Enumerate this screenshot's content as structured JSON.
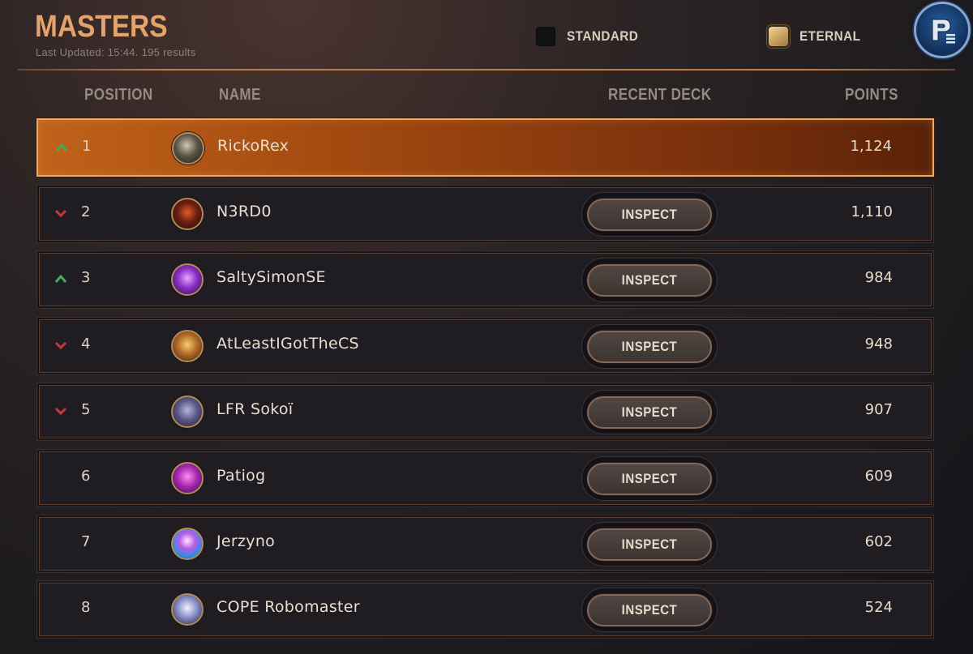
{
  "header": {
    "title": "MASTERS",
    "subtitle": "Last Updated: 15:44. 195 results",
    "modes": [
      {
        "label": "STANDARD",
        "selected": false
      },
      {
        "label": "ETERNAL",
        "selected": true
      }
    ],
    "logo_icon": "rank-profile-icon"
  },
  "columns": {
    "position": "POSITION",
    "name": "NAME",
    "recent_deck": "RECENT DECK",
    "points": "POINTS"
  },
  "colors": {
    "accent": "#e3a36a",
    "up": "#3fae5a",
    "down": "#c5383c",
    "highlight": "#a14910"
  },
  "rows": [
    {
      "position": "1",
      "name": "RickoRex",
      "points": "1,124",
      "trend": "up",
      "inspect": "",
      "avatar_icon": "dragon-avatar-icon",
      "highlight": true
    },
    {
      "position": "2",
      "name": "N3RD0",
      "points": "1,110",
      "trend": "down",
      "inspect": "INSPECT",
      "avatar_icon": "champion-avatar-icon"
    },
    {
      "position": "3",
      "name": "SaltySimonSE",
      "points": "984",
      "trend": "up",
      "inspect": "INSPECT",
      "avatar_icon": "crystal-avatar-icon"
    },
    {
      "position": "4",
      "name": "AtLeastIGotTheCS",
      "points": "948",
      "trend": "down",
      "inspect": "INSPECT",
      "avatar_icon": "fox-avatar-icon"
    },
    {
      "position": "5",
      "name": "LFR Sokoï",
      "points": "907",
      "trend": "down",
      "inspect": "INSPECT",
      "avatar_icon": "wolf-avatar-icon"
    },
    {
      "position": "6",
      "name": "Patiog",
      "points": "609",
      "trend": "none",
      "inspect": "INSPECT",
      "avatar_icon": "poro-avatar-icon"
    },
    {
      "position": "7",
      "name": "Jerzyno",
      "points": "602",
      "trend": "none",
      "inspect": "INSPECT",
      "avatar_icon": "mushroom-avatar-icon"
    },
    {
      "position": "8",
      "name": "COPE Robomaster",
      "points": "524",
      "trend": "none",
      "inspect": "INSPECT",
      "avatar_icon": "spirit-avatar-icon"
    }
  ]
}
